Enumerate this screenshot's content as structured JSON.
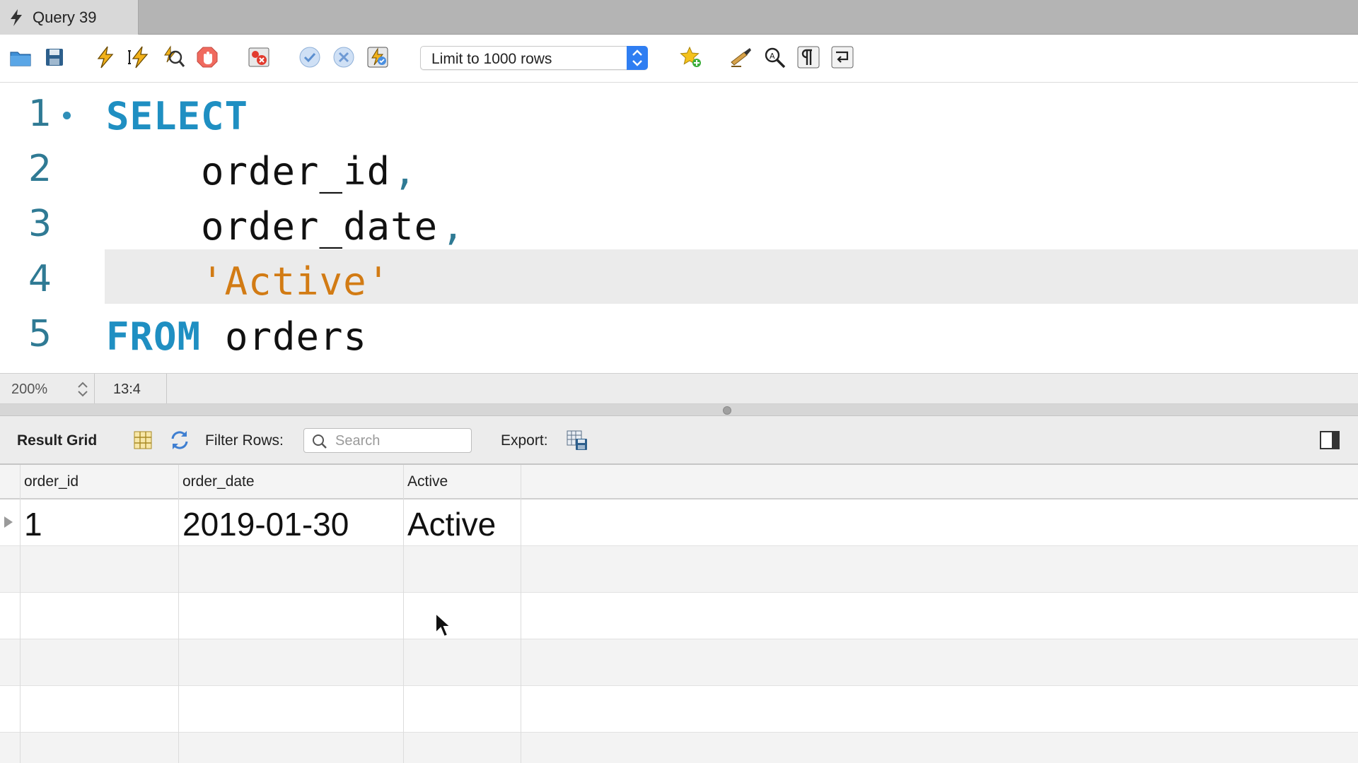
{
  "tab": {
    "title": "Query 39"
  },
  "toolbar": {
    "limit_select": "Limit to 1000 rows",
    "buttons": [
      "open-folder-icon",
      "save-icon",
      "execute-icon",
      "execute-current-icon",
      "explain-icon",
      "stop-icon",
      "toggle-error-icon",
      "commit-icon",
      "rollback-icon",
      "autocommit-icon",
      "add-snippet-icon",
      "beautify-icon",
      "find-icon",
      "invisibles-icon",
      "wrap-icon"
    ]
  },
  "editor": {
    "lines": [
      {
        "num": "1",
        "code": "SELECT"
      },
      {
        "num": "2",
        "code": "    order_id,"
      },
      {
        "num": "3",
        "code": "    order_date,"
      },
      {
        "num": "4",
        "code": "    'Active'"
      },
      {
        "num": "5",
        "code": "FROM orders"
      }
    ],
    "line1_keyword": "SELECT",
    "line2_ident": "order_id",
    "line3_ident": "order_date",
    "line4_string": "'Active'",
    "line5_keyword": "FROM",
    "line5_ident": "orders",
    "comma": ","
  },
  "status": {
    "zoom": "200%",
    "cursor_pos": "13:4"
  },
  "results": {
    "title": "Result Grid",
    "filter_label": "Filter Rows:",
    "search_placeholder": "Search",
    "export_label": "Export:",
    "columns": [
      "order_id",
      "order_date",
      "Active"
    ],
    "rows": [
      [
        "1",
        "2019-01-30",
        "Active"
      ]
    ]
  },
  "colors": {
    "keyword": "#1f8fc2",
    "string": "#d27b14",
    "line_number": "#2f7a94",
    "accent": "#2f7ef2"
  }
}
